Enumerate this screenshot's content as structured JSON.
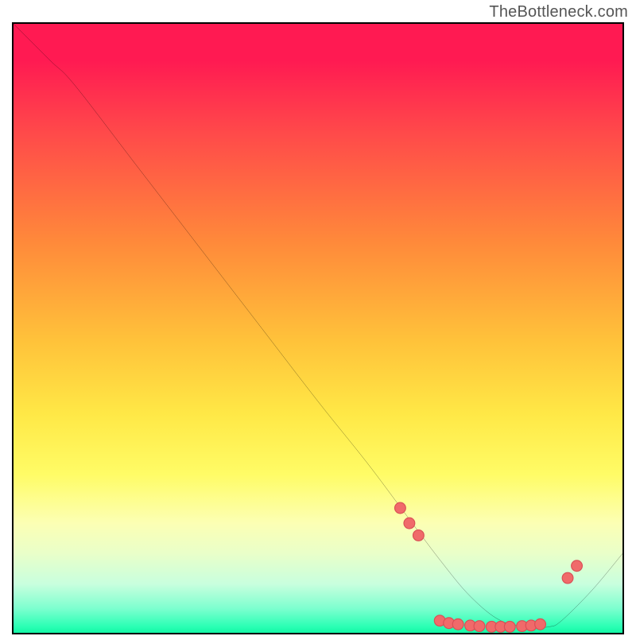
{
  "attribution": "TheBottleneck.com",
  "colors": {
    "top": "#ff1a52",
    "mid_orange": "#ffb03a",
    "mid_yellow": "#fff25a",
    "bottom": "#13f7a6",
    "line": "#000000",
    "marker_fill": "#f06a6a",
    "marker_stroke": "#d94f55"
  },
  "chart_data": {
    "type": "line",
    "title": "",
    "xlabel": "",
    "ylabel": "",
    "xlim": [
      0,
      100
    ],
    "ylim": [
      0,
      100
    ],
    "grid": false,
    "legend": false,
    "series": [
      {
        "name": "bottleneck-curve",
        "x": [
          0,
          6,
          10,
          20,
          30,
          40,
          50,
          58,
          64,
          70,
          75,
          80,
          85,
          88,
          90,
          95,
          100
        ],
        "y": [
          100,
          94,
          90,
          77,
          64,
          51,
          38,
          28,
          20,
          12,
          6,
          2,
          1,
          1,
          2,
          7,
          13
        ]
      }
    ],
    "markers": {
      "name": "highlight-points",
      "points": [
        {
          "x": 63.5,
          "y": 20.5
        },
        {
          "x": 65.0,
          "y": 18.0
        },
        {
          "x": 66.5,
          "y": 16.0
        },
        {
          "x": 70.0,
          "y": 2.0
        },
        {
          "x": 71.5,
          "y": 1.6
        },
        {
          "x": 73.0,
          "y": 1.4
        },
        {
          "x": 75.0,
          "y": 1.2
        },
        {
          "x": 76.5,
          "y": 1.1
        },
        {
          "x": 78.5,
          "y": 1.0
        },
        {
          "x": 80.0,
          "y": 1.0
        },
        {
          "x": 81.5,
          "y": 1.0
        },
        {
          "x": 83.5,
          "y": 1.1
        },
        {
          "x": 85.0,
          "y": 1.2
        },
        {
          "x": 86.5,
          "y": 1.4
        },
        {
          "x": 91.0,
          "y": 9.0
        },
        {
          "x": 92.5,
          "y": 11.0
        }
      ]
    }
  }
}
